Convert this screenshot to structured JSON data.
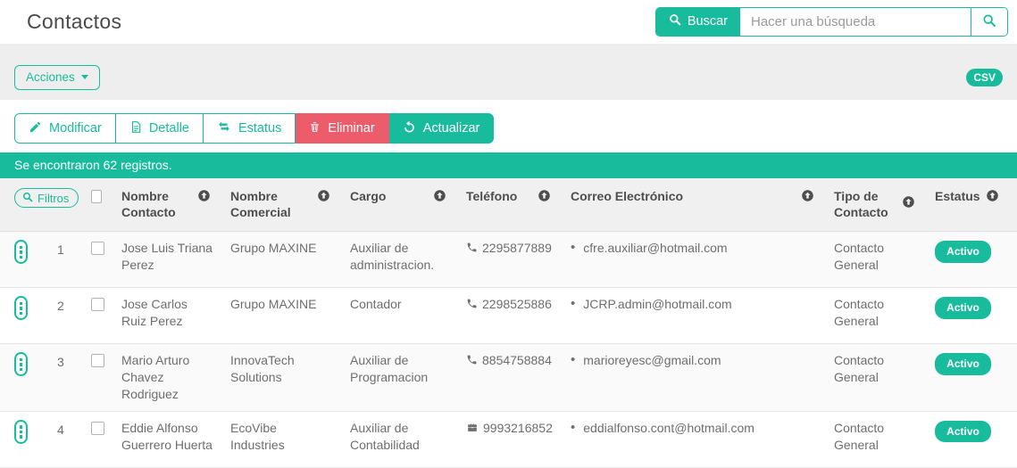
{
  "page": {
    "title": "Contactos"
  },
  "search": {
    "button_label": "Buscar",
    "placeholder": "Hacer una búsqueda"
  },
  "actions_menu": {
    "label": "Acciones"
  },
  "export": {
    "csv_label": "CSV"
  },
  "toolbar": {
    "modificar": "Modificar",
    "detalle": "Detalle",
    "estatus": "Estatus",
    "eliminar": "Eliminar",
    "actualizar": "Actualizar"
  },
  "results": {
    "message": "Se encontraron 62 registros."
  },
  "filters": {
    "label": "Filtros"
  },
  "table": {
    "columns": {
      "nombre_contacto": "Nombre Contacto",
      "nombre_comercial": "Nombre Comercial",
      "cargo": "Cargo",
      "telefono": "Teléfono",
      "correo": "Correo Electrónico",
      "tipo_contacto": "Tipo de Contacto",
      "estatus": "Estatus"
    },
    "rows": [
      {
        "num": "1",
        "nombre_contacto": "Jose Luis Triana Perez",
        "nombre_comercial": "Grupo MAXINE",
        "cargo": "Auxiliar de administracion.",
        "telefono": "2295877889",
        "telefono_icon": "phone-icon",
        "correo": "cfre.auxiliar@hotmail.com",
        "tipo_contacto": "Contacto General",
        "estatus": "Activo"
      },
      {
        "num": "2",
        "nombre_contacto": "Jose Carlos Ruiz Perez",
        "nombre_comercial": "Grupo MAXINE",
        "cargo": "Contador",
        "telefono": "2298525886",
        "telefono_icon": "phone-icon",
        "correo": "JCRP.admin@hotmail.com",
        "tipo_contacto": "Contacto General",
        "estatus": "Activo"
      },
      {
        "num": "3",
        "nombre_contacto": "Mario Arturo Chavez Rodriguez",
        "nombre_comercial": "InnovaTech Solutions",
        "cargo": "Auxiliar de Programacion",
        "telefono": "8854758884",
        "telefono_icon": "phone-icon",
        "correo": "marioreyesc@gmail.com",
        "tipo_contacto": "Contacto General",
        "estatus": "Activo"
      },
      {
        "num": "4",
        "nombre_contacto": "Eddie Alfonso Guerrero Huerta",
        "nombre_comercial": "EcoVibe Industries",
        "cargo": "Auxiliar de Contabilidad",
        "telefono": "9993216852",
        "telefono_icon": "briefcase-icon",
        "correo": "eddialfonso.cont@hotmail.com",
        "tipo_contacto": "Contacto General",
        "estatus": "Activo"
      }
    ]
  },
  "colors": {
    "accent_teal": "#18bc9c",
    "danger_red": "#ec5c6b"
  }
}
